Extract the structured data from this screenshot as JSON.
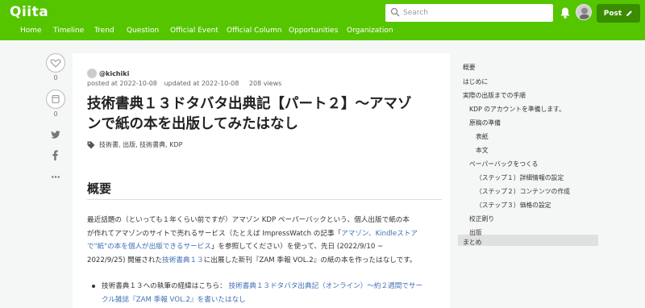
{
  "header": {
    "logo": "Qiita",
    "search_placeholder": "Search",
    "post_label": "Post"
  },
  "nav": [
    "Home",
    "Timeline",
    "Trend",
    "Question",
    "Official Event",
    "Official Column",
    "Opportunities",
    "Organization"
  ],
  "rail": {
    "likes": "0",
    "stocks": "0"
  },
  "article": {
    "author": "@kichiki",
    "posted": "posted at 2022-10-08",
    "updated": "updated at 2022-10-08",
    "views": "208 views",
    "title_l1": "技術書典１３ドタバタ出典記【パート２】〜アマゾ",
    "title_l2": "ンで紙の本を出版してみたはなし",
    "tags": "技術書, 出版, 技術書典, KDP",
    "heading": "概要",
    "p_line1": "最近話題の（といっても１年くらい前ですが）アマゾン KDP ペーパーバックという、個人出版で紙の本",
    "p_line2a": "が作れてアマゾンのサイトで売れるサービス（たとえば ImpressWatch の記事「",
    "p_line2b": "アマゾン、Kindleストア",
    "p_line3a": "で\"紙\"の本を個人が出版できるサービス",
    "p_line3b": "」を参照してください）を使って、先日 (2022/9/10 ~",
    "p_line4a": "2022/9/25) 開催された",
    "p_line4b": "技術書典１３",
    "p_line4c": "に出展した新刊『ZAM 季報 VOL.2』の紙の本を作ったはなしです。",
    "bullet_a": "技術書典１３への執筆の経緯はこちら：",
    "bullet_b": "技術書典１３ドタバタ出典記（オンライン）〜約２週間でサー",
    "bullet_c": "クル雑誌『ZAM 季報 VOL.2』を書いたはなし"
  },
  "toc": [
    "概要",
    "はじめに",
    "実際の出版までの手順",
    "KDP のアカウントを準備します。",
    "原稿の準備",
    "表紙",
    "本文",
    "ペーパーバックをつくる",
    "（ステップ１）詳細情報の設定",
    "（ステップ２）コンテンツの作成",
    "（ステップ３）価格の設定",
    "校正刷り",
    "出版",
    "まとめ"
  ],
  "colors": {
    "brand": "#55c500",
    "post_button": "#3a8c00",
    "link": "#3f70b5"
  }
}
